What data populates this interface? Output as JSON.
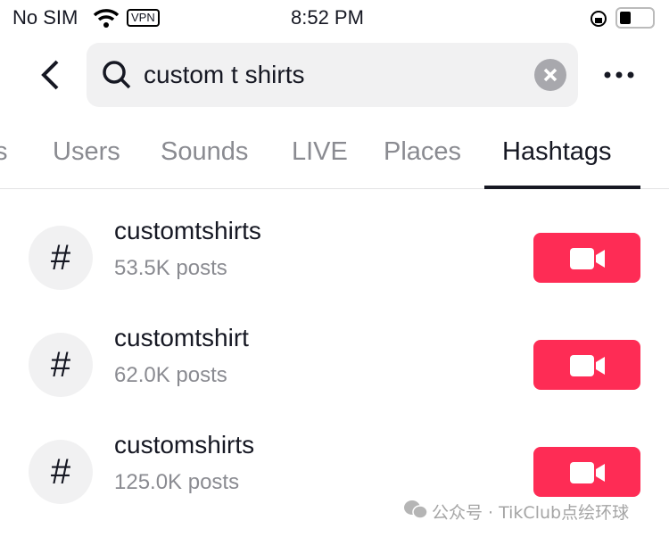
{
  "status_bar": {
    "carrier": "No SIM",
    "vpn": "VPN",
    "time": "8:52 PM",
    "battery_level": 0.3
  },
  "search": {
    "query": "custom t shirts"
  },
  "tabs": [
    {
      "label": "s"
    },
    {
      "label": "Users"
    },
    {
      "label": "Sounds"
    },
    {
      "label": "LIVE"
    },
    {
      "label": "Places"
    },
    {
      "label": "Hashtags",
      "active": true
    }
  ],
  "results": [
    {
      "symbol": "#",
      "name": "customtshirts",
      "posts": "53.5K posts"
    },
    {
      "symbol": "#",
      "name": "customtshirt",
      "posts": "62.0K posts"
    },
    {
      "symbol": "#",
      "name": "customshirts",
      "posts": "125.0K posts"
    }
  ],
  "watermark": "公众号 · TikClub点绘环球",
  "colors": {
    "accent": "#fe2c55",
    "text": "#161823",
    "muted": "#8a8b91"
  }
}
